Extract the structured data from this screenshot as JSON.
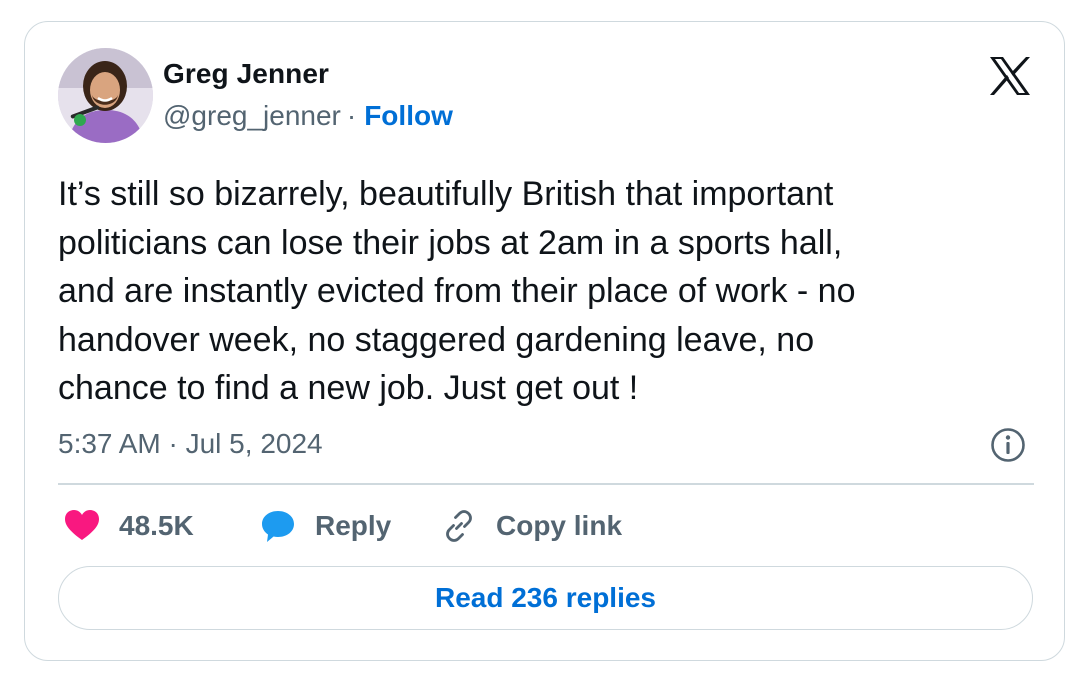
{
  "author": {
    "name": "Greg Jenner",
    "handle": "@greg_jenner",
    "separator": "·",
    "follow_label": "Follow"
  },
  "tweet": {
    "text": "It’s still so bizarrely, beautifully British that important\npoliticians can lose their jobs at 2am in a sports hall,\nand are instantly evicted from their place of work - no\nhandover week, no staggered gardening leave, no\nchance to find a new job. Just get out !",
    "timestamp": "5:37 AM · Jul 5, 2024"
  },
  "actions": {
    "like_count": "48.5K",
    "reply_label": "Reply",
    "copy_link_label": "Copy link"
  },
  "replies_button": {
    "label": "Read 236 replies"
  },
  "icons": {
    "brand": "x-logo-icon",
    "info": "info-icon",
    "like": "heart-icon",
    "reply": "speech-bubble-icon",
    "copy": "link-icon"
  },
  "colors": {
    "link_blue": "#006fd6",
    "heart_pink": "#f91880",
    "reply_blue": "#1d9bf0",
    "muted_text": "#536471",
    "border": "#cfd9de",
    "text": "#0f1419"
  }
}
